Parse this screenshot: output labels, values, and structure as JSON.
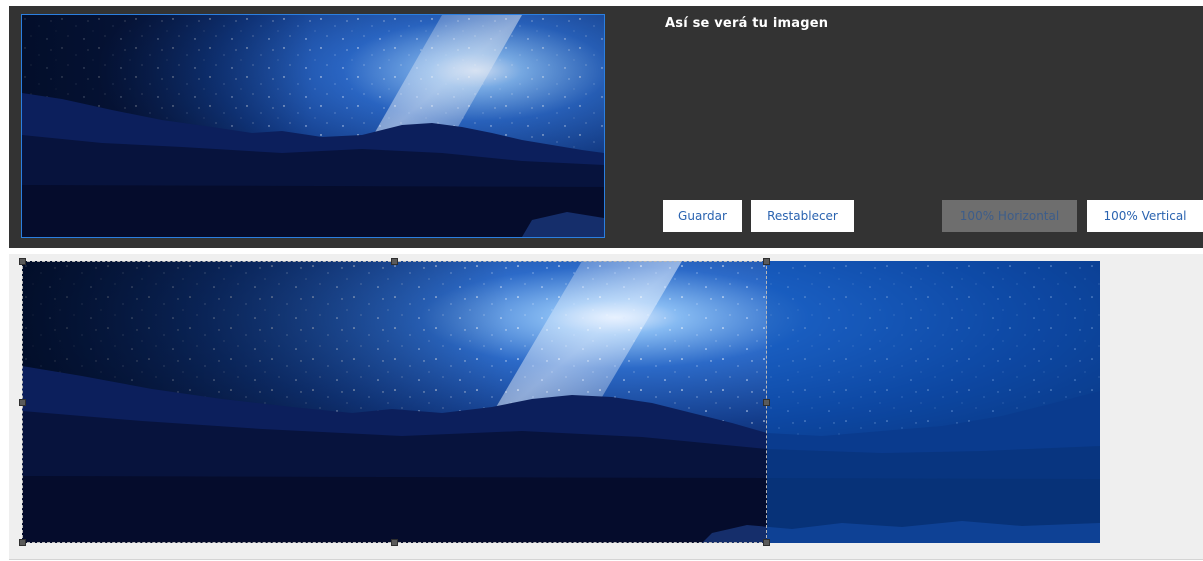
{
  "preview": {
    "title": "Así se verá tu imagen"
  },
  "buttons": {
    "save_label": "Guardar",
    "reset_label": "Restablecer",
    "horizontal_label": "100% Horizontal",
    "vertical_label": "100% Vertical"
  },
  "colors": {
    "panel_background": "#333333",
    "editor_background": "#efefef",
    "preview_border": "#2b7fe0",
    "button_text": "#2a63b0",
    "disabled_button": "#6e6e6e"
  }
}
